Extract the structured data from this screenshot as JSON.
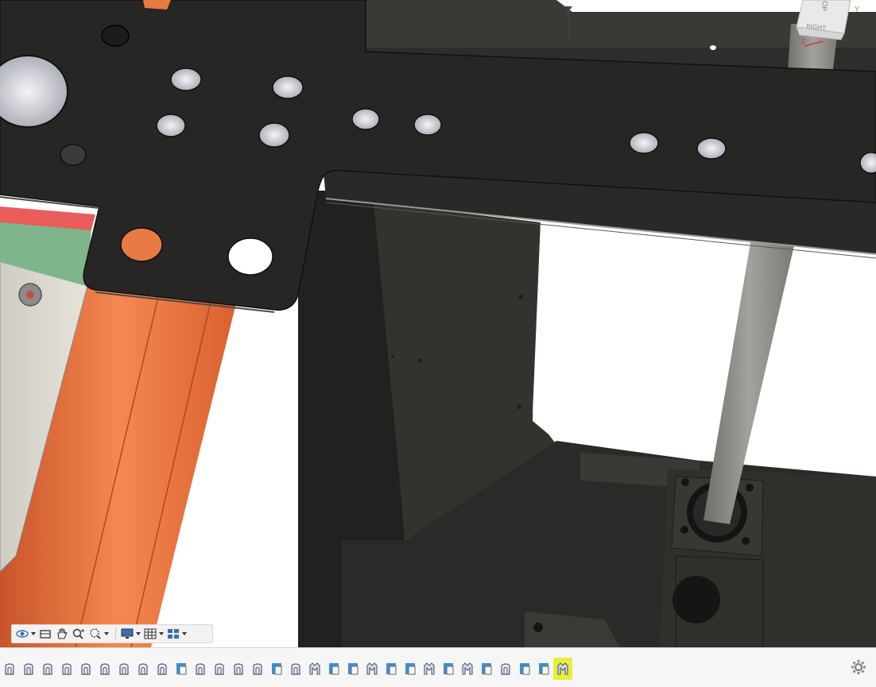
{
  "viewcube": {
    "face_label": "RIGHT",
    "top_label": "OP",
    "axis_y": "Y",
    "axis_z": "Z"
  },
  "nav_toolbar": {
    "tools": [
      {
        "name": "orbit",
        "icon": "orbit-icon",
        "has_dropdown": true
      },
      {
        "name": "look-at",
        "icon": "look-at-icon",
        "has_dropdown": false
      },
      {
        "name": "pan",
        "icon": "pan-hand-icon",
        "has_dropdown": false
      },
      {
        "name": "zoom",
        "icon": "zoom-icon",
        "has_dropdown": false
      },
      {
        "name": "fit",
        "icon": "zoom-window-icon",
        "has_dropdown": true
      },
      {
        "name": "display-settings",
        "icon": "display-monitor-icon",
        "has_dropdown": true
      },
      {
        "name": "grid-snaps",
        "icon": "grid-icon",
        "has_dropdown": true
      },
      {
        "name": "viewports",
        "icon": "viewports-icon",
        "has_dropdown": true
      }
    ]
  },
  "timeline": {
    "features": [
      "extrude",
      "extrude",
      "extrude",
      "extrude",
      "extrude",
      "extrude",
      "extrude",
      "extrude",
      "extrude",
      "sketch",
      "extrude",
      "extrude",
      "extrude",
      "extrude",
      "sketch",
      "extrude",
      "joint",
      "sketch",
      "sketch",
      "joint",
      "sketch",
      "sketch",
      "joint",
      "sketch",
      "joint",
      "sketch",
      "extrude",
      "sketch",
      "sketch",
      "joint"
    ],
    "active_index": 29
  },
  "colors": {
    "accent_active": "#e8ee3a",
    "sketch_blue": "#3b8fd9",
    "plate_black": "#262624",
    "rail_orange": "#e86f3a",
    "rail_green": "#7fb58a",
    "rail_red": "#e25a5a",
    "shaft_gray": "#8f8e88"
  }
}
